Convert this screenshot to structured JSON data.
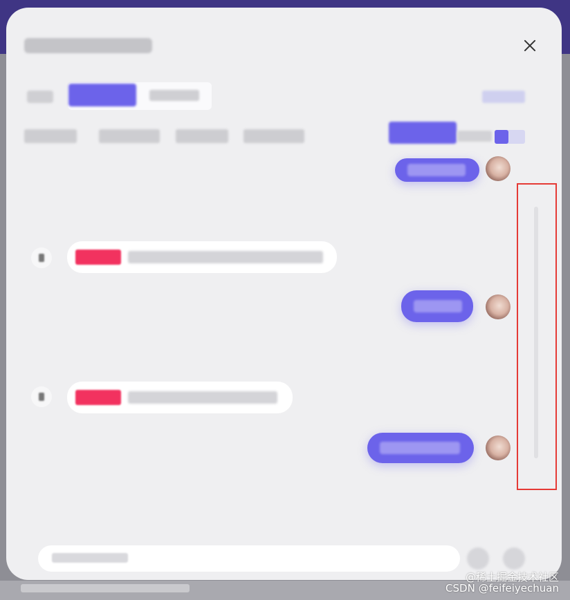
{
  "dialog": {
    "title": "",
    "close_icon": "close-icon"
  },
  "mode": {
    "label": "",
    "tabs": [
      {
        "label": "",
        "active": true
      },
      {
        "label": "",
        "active": false
      }
    ],
    "right_link": ""
  },
  "filters": {
    "items": [
      "",
      "",
      "",
      ""
    ],
    "active_button": "",
    "count": ""
  },
  "messages": [
    {
      "role": "user",
      "text": ""
    },
    {
      "role": "assistant",
      "tag": "",
      "text": ""
    },
    {
      "role": "user",
      "text": ""
    },
    {
      "role": "assistant",
      "tag": "",
      "text": ""
    },
    {
      "role": "user",
      "text": ""
    }
  ],
  "composer": {
    "placeholder": ""
  },
  "watermark": {
    "line1": "@稀土掘金技术社区",
    "line2": "CSDN @feifeiyechuan"
  },
  "colors": {
    "accent": "#6c63ea",
    "tag": "#f2325f",
    "highlight": "#e53935",
    "header": "#3f3584"
  }
}
